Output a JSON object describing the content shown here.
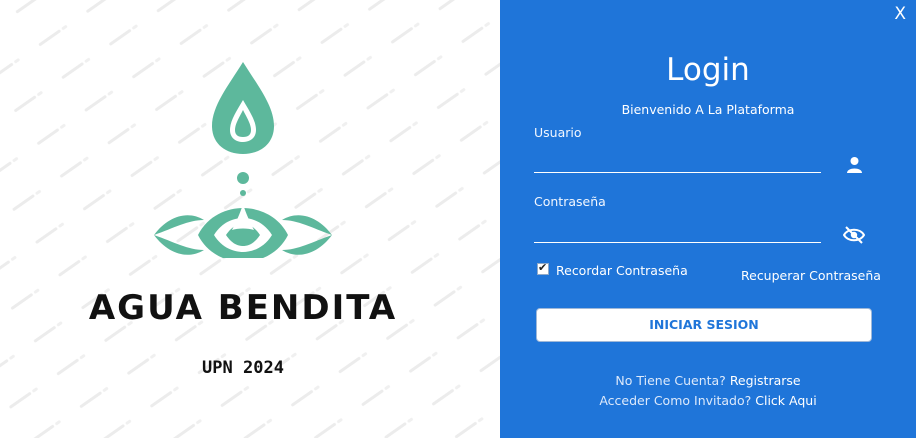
{
  "brand": {
    "name": "AGUA BENDITA",
    "subtitle": "UPN 2024"
  },
  "window": {
    "close_label": "X"
  },
  "login": {
    "title": "Login",
    "welcome": "Bienvenido A La Plataforma",
    "user_label": "Usuario",
    "user_value": "",
    "password_label": "Contraseña",
    "password_value": "",
    "remember_label": "Recordar Contraseña",
    "remember_checked": true,
    "recover_label": "Recuperar Contraseña",
    "submit_label": "INICIAR SESION",
    "no_account_text": "No Tiene Cuenta?",
    "register_link": "Registrarse",
    "guest_text": "Acceder Como Invitado?",
    "guest_link": "Click Aqui"
  },
  "colors": {
    "panel": "#1f75d9",
    "logo": "#5db89c",
    "text_dark": "#111111"
  },
  "icons": {
    "user": "user-icon",
    "password_toggle": "eye-slash-icon",
    "logo": "water-drop-icon"
  }
}
